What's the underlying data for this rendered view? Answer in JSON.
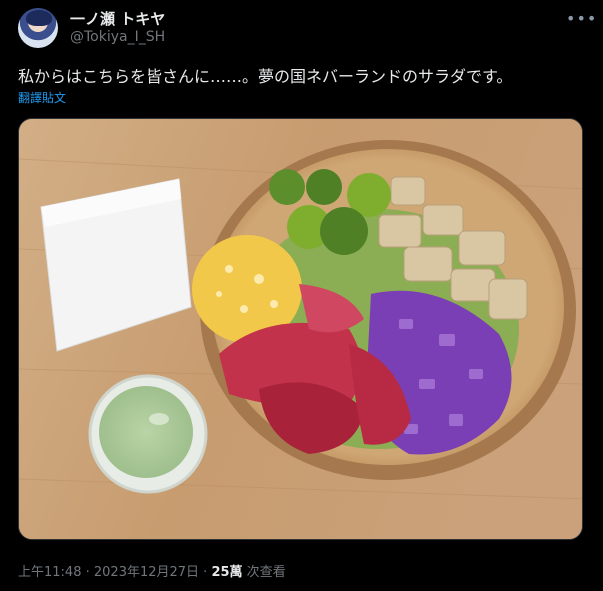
{
  "author": {
    "display_name": "一ノ瀬 トキヤ",
    "handle": "@Tokiya_I_SH"
  },
  "post": {
    "text": "私からはこちらを皆さんに……。夢の国ネバーランドのサラダです。",
    "translate_label": "翻譯貼文",
    "more_icon": "more-icon"
  },
  "meta": {
    "time": "上午11:48",
    "separator": " · ",
    "date": "2023年12月27日",
    "separator2": " · ",
    "views": "25萬",
    "views_label": " 次查看"
  }
}
